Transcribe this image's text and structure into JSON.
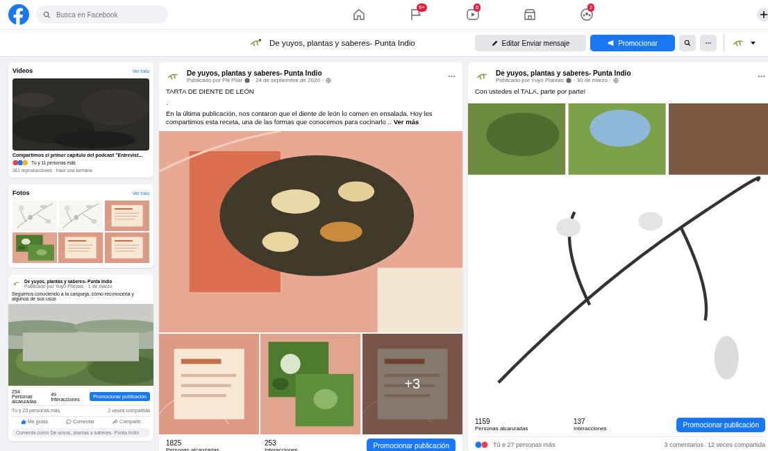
{
  "top_bar": {
    "search": {
      "placeholder": "Busca en Facebook"
    },
    "nav": [
      {
        "kind": "home"
      },
      {
        "kind": "flag",
        "badge": "9+"
      },
      {
        "kind": "video",
        "badge": "6"
      },
      {
        "kind": "store"
      },
      {
        "kind": "groups",
        "badge": "2"
      }
    ]
  },
  "page_bar": {
    "name": "De yuyos, plantas y saberes- Punta Indio",
    "buttons": [
      {
        "label": "Editar Enviar mensaje",
        "kind": "edit"
      },
      {
        "label": "Promocionar",
        "kind": "promote"
      }
    ]
  },
  "videos_card": {
    "title": "Videos",
    "link": "Ver todo",
    "caption": "Compartimos el primer capítulo del podcast \"Entrevist...",
    "reactions": "Tú y 11 personas más",
    "meta": "361 reproducciones · hace una semana"
  },
  "photos_card": {
    "title": "Fotos",
    "link": "Ver todo"
  },
  "small_post": {
    "page": "De yuyos, plantas y saberes- Punta Indio",
    "author": "Publicado por Yuyo Plantas · 1 de marzo",
    "text": "Seguimos conociendo a la carqueja, cómo reconocerla y algunos de sus usos",
    "stats": [
      {
        "value": "254",
        "label": "Personas alcanzadas"
      },
      {
        "value": "49",
        "label": "Interacciones"
      }
    ],
    "promote": "Promocionar publicación",
    "reactions": "Tú y 23 personas más",
    "shares": "2 veces compartida",
    "actions": [
      {
        "label": "Me gusta",
        "kind": "like"
      },
      {
        "label": "Comentar",
        "kind": "comment"
      },
      {
        "label": "Compartir",
        "kind": "share"
      }
    ],
    "comment": {
      "placeholder": "Comenta como De yuyos, plantas y saberes- Punta Indio"
    }
  },
  "posts": [
    {
      "page": "De yuyos, plantas y saberes- Punta Indio",
      "author": "Publicado por Pili Pilar",
      "date": "· 24 de septiembre de 2020 ·",
      "title": "TARTA DE DIENTE DE LEÓN",
      "body": [
        ".",
        " En la última publicación, nos contaron que el diente de león lo comen en ensalada. Hoy les compartimos esta receta, una de las formas que conocemos para cocinarlo .."
      ],
      "more": "Ver más",
      "media": {
        "kind": "photo_set",
        "more_photos": "+3"
      },
      "stats": [
        {
          "value": "1825",
          "label": "Personas alcanzadas"
        },
        {
          "value": "253",
          "label": "Interacciones"
        }
      ],
      "promote": "Promocionar publicación"
    },
    {
      "page": "De yuyos, plantas y saberes- Punta Indio",
      "author": "Publicado por Yuyo Plantas",
      "date": "· 30 de marzo ·",
      "title": "Con ustedes el TALA, parte por parte!",
      "media": {
        "kind": "drawing"
      },
      "stats": [
        {
          "value": "1159",
          "label": "Personas alcanzadas"
        },
        {
          "value": "137",
          "label": "Interacciones"
        }
      ],
      "promote": "Promocionar publicación",
      "reactions": "Tú e 27 personas más",
      "comments": "3 comentarios",
      "shares": "12 veces compartida"
    }
  ]
}
